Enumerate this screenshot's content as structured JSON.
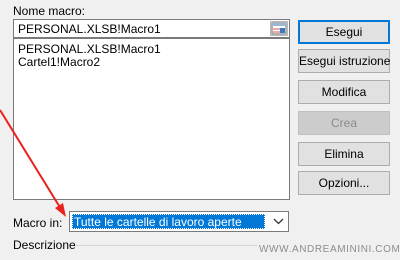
{
  "dialog": {
    "name_label": "Nome macro:",
    "name_value": "PERSONAL.XLSB!Macro1",
    "macros": [
      "PERSONAL.XLSB!Macro1",
      "Cartel1!Macro2"
    ],
    "buttons": {
      "run": "Esegui",
      "step_into": "Esegui istruzione",
      "edit": "Modifica",
      "create": "Crea",
      "delete": "Elimina",
      "options": "Opzioni..."
    },
    "macro_in_label": "Macro in:",
    "macro_in_value": "Tutte le cartelle di lavoro aperte",
    "description_label": "Descrizione"
  },
  "watermark": "WWW.ANDREAMININI.COM",
  "annotation": {
    "arrow_color": "#e8211d"
  },
  "icons": {
    "picker": "collapse-dialog-icon",
    "dropdown": "chevron-down-icon"
  },
  "colors": {
    "selection": "#0078d7",
    "default_button_border": "#0078d7",
    "dialog_background": "#f0f0f0"
  }
}
